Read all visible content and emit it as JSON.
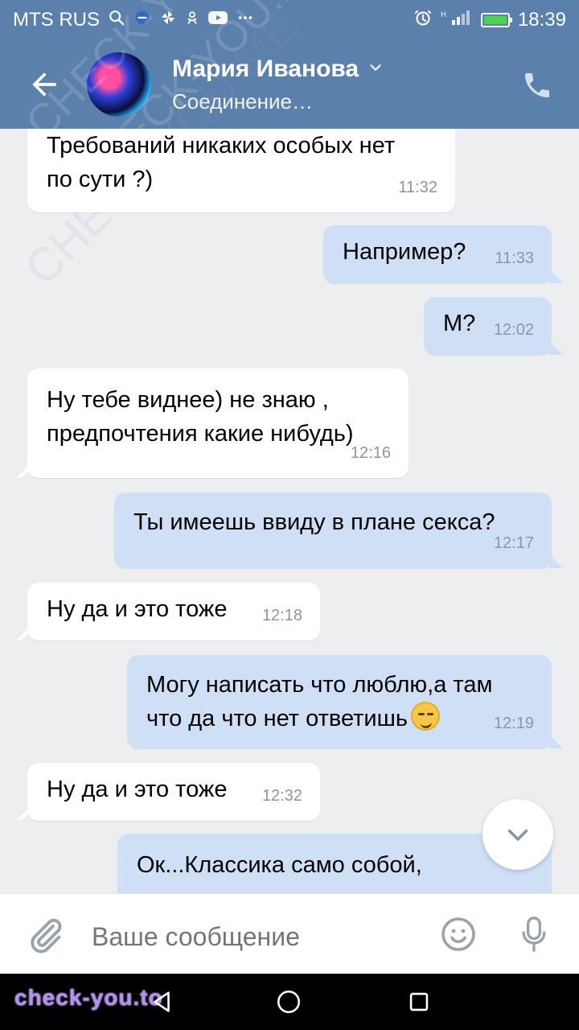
{
  "status_bar": {
    "carrier": "MTS RUS",
    "time": "18:39"
  },
  "header": {
    "contact_name": "Мария Иванова",
    "connection_status": "Соединение…"
  },
  "messages": [
    {
      "dir": "in",
      "text_lines": [
        "Требований никаких особых нет",
        "по сути ?)"
      ],
      "time": "11:32"
    },
    {
      "dir": "out",
      "text_lines": [
        "Например?"
      ],
      "time": "11:33"
    },
    {
      "dir": "out",
      "text_lines": [
        "М?"
      ],
      "time": "12:02"
    },
    {
      "dir": "in",
      "text_lines": [
        "Ну тебе виднее) не знаю ,",
        "предпочтения какие нибудь)"
      ],
      "time": "12:16"
    },
    {
      "dir": "out",
      "text_lines": [
        "Ты имеешь ввиду в плане секса?"
      ],
      "time": "12:17"
    },
    {
      "dir": "in",
      "text_lines": [
        "Ну да и это тоже"
      ],
      "time": "12:18"
    },
    {
      "dir": "out",
      "text_lines": [
        "Могу написать что люблю,а там",
        "что да что нет ответишь"
      ],
      "time": "12:19",
      "emoji_after_last_line": "smirk"
    },
    {
      "dir": "in",
      "text_lines": [
        "Ну да и это тоже"
      ],
      "time": "12:32"
    },
    {
      "dir": "out",
      "text_lines": [
        "Ок...Классика само собой,"
      ],
      "time": ""
    }
  ],
  "composer": {
    "placeholder": "Ваше сообщение"
  },
  "watermarks": {
    "overlay": "CHECK-YOU.ME",
    "bottom": "check-you.to"
  },
  "colors": {
    "header_bg": "#5a80ab",
    "chat_bg": "#edeef0",
    "incoming_bg": "#ffffff",
    "outgoing_bg": "#cfe0f6",
    "time_text": "#8b96a4"
  }
}
